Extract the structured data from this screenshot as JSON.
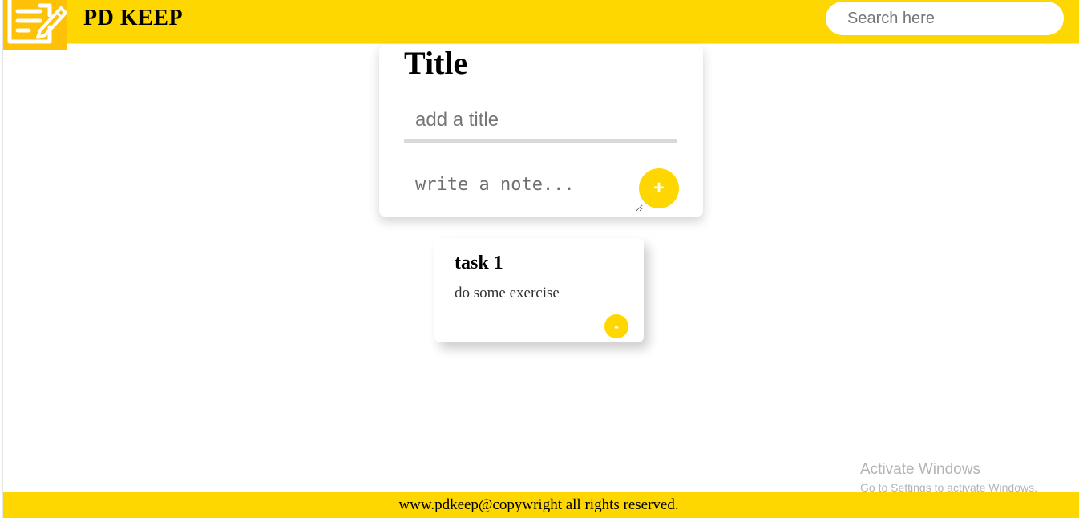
{
  "header": {
    "brand": "PD KEEP",
    "search_placeholder": "Search here",
    "logo_icon": "notepad-pencil-icon"
  },
  "note_form": {
    "heading": "Title",
    "title_placeholder": "add a title",
    "note_placeholder": "write a note...",
    "add_label": "+"
  },
  "notes": [
    {
      "title": "task 1",
      "body": "do some exercise",
      "delete_label": "-"
    }
  ],
  "watermark": {
    "title": "Activate Windows",
    "subtitle": "Go to Settings to activate Windows."
  },
  "footer": {
    "text": "www.pdkeep@copywright all rights reserved."
  },
  "colors": {
    "accent": "#ffd700",
    "logo_bg": "#ffc107",
    "text": "#000000"
  }
}
